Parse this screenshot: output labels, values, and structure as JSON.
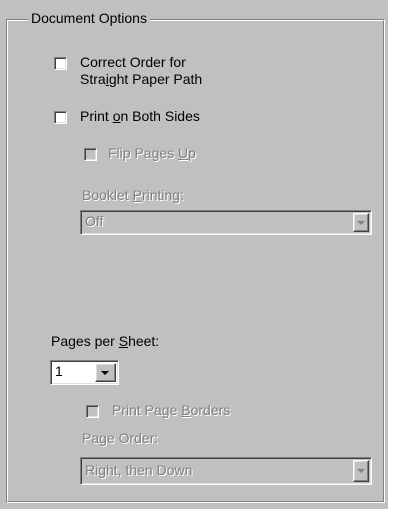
{
  "document_options": {
    "title": "Document Options",
    "correct_order": {
      "line1": "Correct Order for",
      "line2_pre": "Stra",
      "line2_mnemonic": "i",
      "line2_post": "ght Paper Path",
      "checked": false
    },
    "print_both_sides": {
      "pre": "Print ",
      "mnemonic": "o",
      "post": "n Both Sides",
      "checked": false
    },
    "flip_pages_up": {
      "pre": "Flip Pages ",
      "mnemonic": "U",
      "post": "p",
      "checked": false,
      "enabled": false
    },
    "booklet_printing": {
      "pre": "Booklet ",
      "mnemonic": "P",
      "post": "rinting:",
      "value": "Off",
      "enabled": false
    },
    "pages_per_sheet": {
      "pre": "Pages per ",
      "mnemonic": "S",
      "post": "heet:",
      "value": "1"
    },
    "print_page_borders": {
      "pre": "Print Page ",
      "mnemonic": "B",
      "post": "orders",
      "checked": false,
      "enabled": false
    },
    "page_order": {
      "pre": "Pa",
      "mnemonic": "g",
      "post": "e Order:",
      "value": "Right, then Down",
      "enabled": false
    }
  }
}
